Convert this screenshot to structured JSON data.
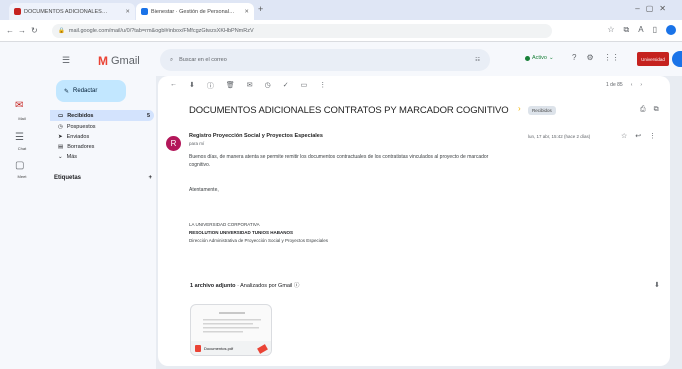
{
  "browser": {
    "tabs": [
      {
        "title": "DOCUMENTOS ADICIONALES…",
        "fav_color": "#c5221f"
      },
      {
        "title": "Bienestar · Gestión de Personal…",
        "fav_color": "#1a73e8"
      }
    ],
    "new_tab": "+",
    "url": "mail.google.com/mail/u/0/?tab=rm&ogbl#inbox/FMfcgzGtwzsXKHbPNmRzV"
  },
  "rail": [
    {
      "icon": "mail-icon",
      "glyph": "✉",
      "label": "Mail"
    },
    {
      "icon": "chat-icon",
      "glyph": "☰",
      "label": "Chat"
    },
    {
      "icon": "meet-icon",
      "glyph": "▢",
      "label": "Meet"
    }
  ],
  "app": {
    "name": "Gmail",
    "logo_letter": "M"
  },
  "compose": {
    "label": "Redactar"
  },
  "nav": [
    {
      "label": "Recibidos",
      "count": "5",
      "active": true,
      "glyph": "▭"
    },
    {
      "label": "Pospuestos",
      "count": "",
      "active": false,
      "glyph": "◷"
    },
    {
      "label": "Enviados",
      "count": "",
      "active": false,
      "glyph": "➤"
    },
    {
      "label": "Borradores",
      "count": "",
      "active": false,
      "glyph": "▤"
    },
    {
      "label": "Más",
      "count": "",
      "active": false,
      "glyph": "⌄"
    }
  ],
  "labels_header": {
    "title": "Etiquetas",
    "add": "+"
  },
  "search": {
    "placeholder": "Buscar en el correo"
  },
  "status": {
    "label": "Activo"
  },
  "account": {
    "label": "Universidad"
  },
  "toolbar": [
    "←",
    "⬇",
    "ⓘ",
    "🗑",
    "✉",
    "◷",
    "✓",
    "▭",
    "⋮"
  ],
  "pager": {
    "text": "1 de 85",
    "prev": "‹",
    "next": "›"
  },
  "email": {
    "subject": "DOCUMENTOS ADICIONALES CONTRATOS PY MARCADOR COGNITIVO",
    "label_chip": "Recibidos",
    "sender_initial": "R",
    "sender": "Registro Proyección Social y Proyectos Especiales",
    "to": "para mí",
    "date": "lun, 17 abr, 15:42 (hace 2 días)",
    "body_line1": "Buenos días, de manera atenta se permite remitir los documentos contractuales de los contratistas vinculados al proyecto de marcador",
    "body_line2": "cognitivo.",
    "greeting": "Atentamente,",
    "sig1": "LA UNIVERSIDAD CORPORATIVA",
    "sig2": "RESOLUTION UNIVERSIDAD TUNIOS HABANOS",
    "sig3": "Dirección Administrativa de Proyección Social y Proyectos Especiales"
  },
  "attachments": {
    "title_bold": "1 archivo adjunto",
    "title_rest": " · Analizados por Gmail ⓘ",
    "file": "Documentos.pdf"
  }
}
